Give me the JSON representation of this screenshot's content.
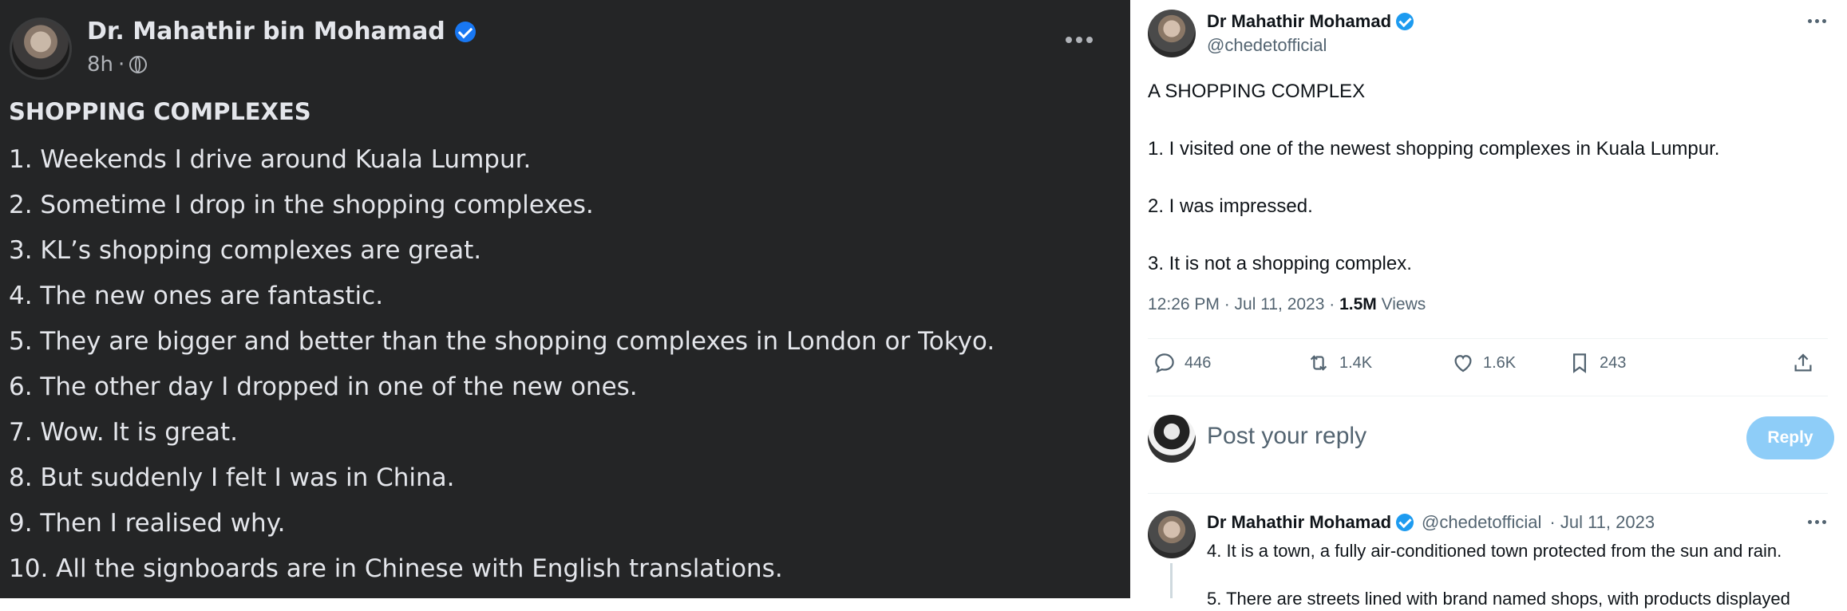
{
  "facebook": {
    "author": "Dr. Mahathir bin Mohamad",
    "time": "8h",
    "separator": "·",
    "title": "SHOPPING COMPLEXES",
    "lines": [
      "1. Weekends I drive around Kuala Lumpur.",
      "2. Sometime I drop in the shopping complexes.",
      "3. KL’s shopping complexes are great.",
      "4. The new ones are fantastic.",
      "5. They are bigger and better than the shopping complexes in London or Tokyo.",
      "6. The other day I dropped in one of the new ones.",
      "7. Wow. It is great.",
      "8. But suddenly I felt I was in China.",
      "9. Then I realised why.",
      "10. All the signboards are in Chinese with English translations."
    ],
    "colors": {
      "background": "#242526",
      "text": "#e4e6eb",
      "muted": "#b0b3b8",
      "verified": "#1877f2"
    }
  },
  "twitter": {
    "author": "Dr Mahathir Mohamad",
    "handle": "@chedetofficial",
    "body": {
      "title": "A SHOPPING COMPLEX",
      "p1": "1. I visited one of the newest shopping complexes in Kuala Lumpur.",
      "p2": "2. I was impressed.",
      "p3": "3. It is not a shopping complex."
    },
    "timestamp": "12:26 PM · Jul 11, 2023 ·",
    "views_count": "1.5M",
    "views_label": "Views",
    "stats": {
      "replies": "446",
      "retweets": "1.4K",
      "likes": "1.6K",
      "bookmarks": "243"
    },
    "reply": {
      "placeholder": "Post your reply",
      "button": "Reply"
    },
    "thread": {
      "author": "Dr Mahathir Mohamad",
      "handle": "@chedetofficial",
      "date": "· Jul 11, 2023",
      "line1": "4. It is a town, a fully air-conditioned town protected from the sun and rain.",
      "line2": "5. There are streets lined with brand named shops, with products displayed"
    },
    "colors": {
      "text": "#0f1419",
      "muted": "#536471",
      "verified": "#1d9bf0",
      "reply_button": "#8ecdf8"
    }
  }
}
